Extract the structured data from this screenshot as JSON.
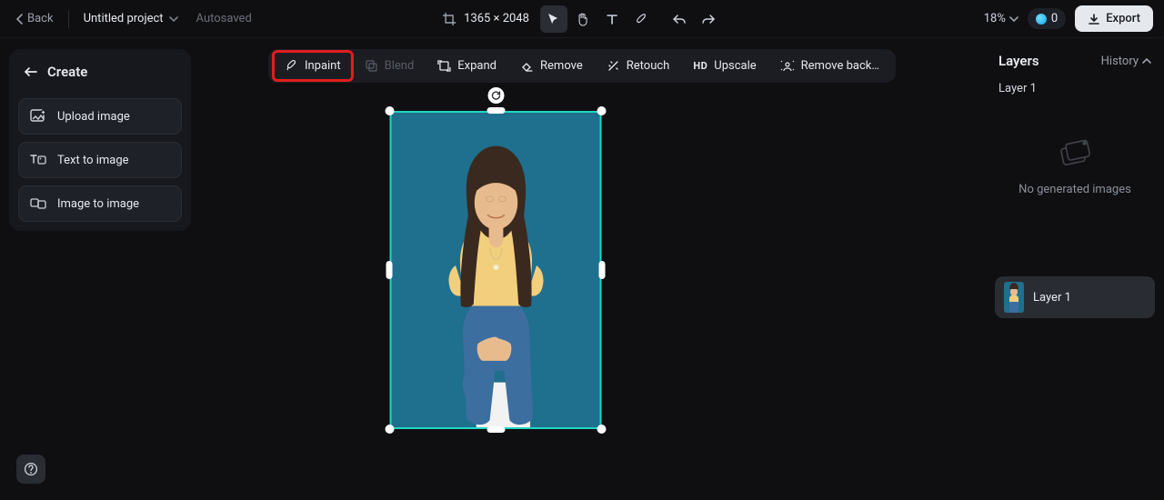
{
  "header": {
    "back_label": "Back",
    "project_title": "Untitled project",
    "autosaved_label": "Autosaved",
    "dimensions": "1365 × 2048",
    "zoom_label": "18%",
    "credit_count": "0",
    "export_label": "Export"
  },
  "create_panel": {
    "title": "Create",
    "items": [
      {
        "label": "Upload image",
        "icon": "upload-image-icon"
      },
      {
        "label": "Text to image",
        "icon": "text-to-image-icon"
      },
      {
        "label": "Image to image",
        "icon": "image-to-image-icon"
      }
    ]
  },
  "toolbar": {
    "items": [
      {
        "label": "Inpaint",
        "icon": "inpaint-icon",
        "highlight": true
      },
      {
        "label": "Blend",
        "icon": "blend-icon",
        "disabled": true
      },
      {
        "label": "Expand",
        "icon": "expand-icon"
      },
      {
        "label": "Remove",
        "icon": "remove-icon"
      },
      {
        "label": "Retouch",
        "icon": "retouch-icon"
      },
      {
        "label": "Upscale",
        "icon": "upscale-icon",
        "hd": true
      },
      {
        "label": "Remove back…",
        "icon": "remove-bg-icon"
      }
    ]
  },
  "canvas": {
    "selected_layer": "Layer 1"
  },
  "right_panel": {
    "title": "Layers",
    "history_label": "History",
    "current_layer_label": "Layer 1",
    "empty_msg": "No generated images",
    "layers": [
      {
        "label": "Layer 1"
      }
    ]
  }
}
